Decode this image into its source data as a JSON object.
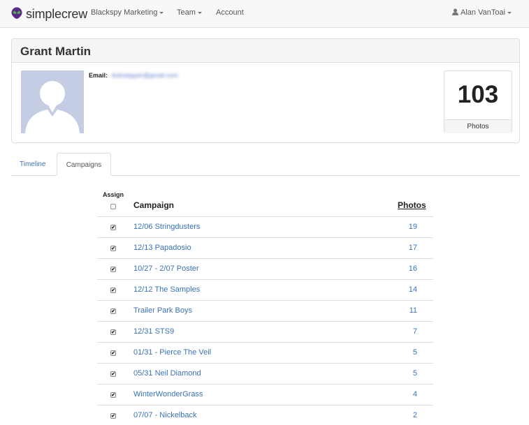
{
  "navbar": {
    "brand": "simplecrew",
    "org_menu": "Blackspy Marketing",
    "team_menu": "Team",
    "account_link": "Account",
    "user_menu": "Alan VanToai"
  },
  "profile": {
    "name": "Grant Martin",
    "email_label": "Email:",
    "email_value": "dubstepper@gmail.com",
    "photo_count": "103",
    "photo_count_label": "Photos"
  },
  "tabs": [
    "Timeline",
    "Campaigns"
  ],
  "table": {
    "assign_header": "Assign",
    "campaign_header": "Campaign",
    "photos_header": "Photos",
    "rows": [
      {
        "campaign": "12/06 Stringdusters",
        "photos": "19"
      },
      {
        "campaign": "12/13 Papadosio",
        "photos": "17"
      },
      {
        "campaign": "10/27 - 2/07 Poster",
        "photos": "16"
      },
      {
        "campaign": "12/12 The Samples",
        "photos": "14"
      },
      {
        "campaign": "Trailer Park Boys",
        "photos": "11"
      },
      {
        "campaign": "12/31 STS9",
        "photos": "7"
      },
      {
        "campaign": "01/31 - Pierce The Veil",
        "photos": "5"
      },
      {
        "campaign": "05/31 Neil Diamond",
        "photos": "5"
      },
      {
        "campaign": "WinterWonderGrass",
        "photos": "4"
      },
      {
        "campaign": "07/07 - Nickelback",
        "photos": "2"
      }
    ]
  },
  "colors": {
    "link": "#3a72b5",
    "navbar_bg": "#f8f8f8",
    "avatar_bg": "#c5cde4",
    "logo_purple": "#5b2a86",
    "logo_green": "#58b947"
  }
}
